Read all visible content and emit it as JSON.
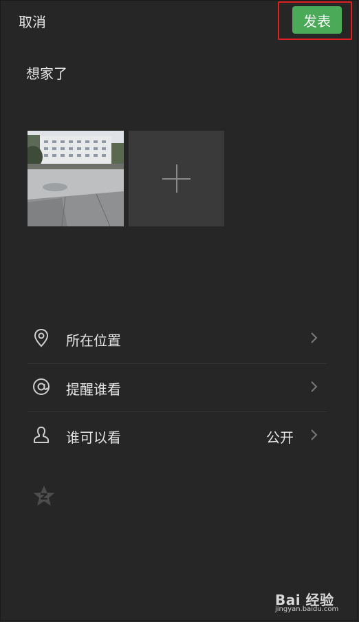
{
  "header": {
    "cancel_label": "取消",
    "publish_label": "发表",
    "publish_color": "#4aaa57",
    "highlight_color": "#e02020"
  },
  "post": {
    "text": "想家了"
  },
  "media": {
    "photo_count": 1,
    "add_icon": "plus-icon"
  },
  "options": [
    {
      "icon": "location-pin-icon",
      "label": "所在位置",
      "value": ""
    },
    {
      "icon": "at-sign-icon",
      "label": "提醒谁看",
      "value": ""
    },
    {
      "icon": "person-icon",
      "label": "谁可以看",
      "value": "公开"
    }
  ],
  "share": {
    "icon": "qzone-star-icon"
  },
  "watermark": {
    "brand": "Bai 经验",
    "url": "jingyan.baidu.com"
  }
}
